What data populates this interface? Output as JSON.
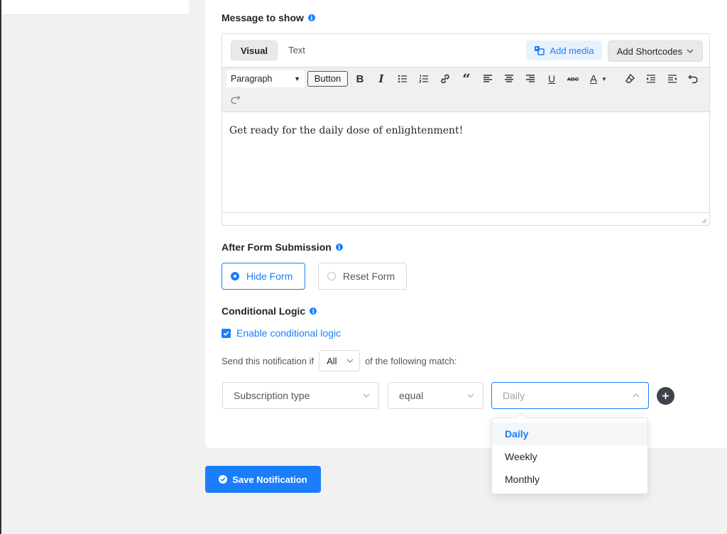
{
  "message_section": {
    "label": "Message to show",
    "tabs": {
      "visual": "Visual",
      "text": "Text"
    },
    "add_media_label": "Add media",
    "add_shortcodes_label": "Add Shortcodes",
    "toolbar": {
      "format_value": "Paragraph",
      "button_label": "Button",
      "icons": [
        "bold-icon",
        "italic-icon",
        "bullet-list-icon",
        "numbered-list-icon",
        "link-icon",
        "blockquote-icon",
        "align-left-icon",
        "align-center-icon",
        "align-right-icon",
        "underline-icon",
        "strikethrough-icon",
        "text-color-icon",
        "clear-formatting-icon",
        "indent-icon",
        "outdent-icon",
        "undo-icon",
        "redo-icon"
      ]
    },
    "body_text": "Get ready for the daily dose of enlightenment!"
  },
  "after_submission": {
    "label": "After Form Submission",
    "options": [
      "Hide Form",
      "Reset Form"
    ],
    "selected": "Hide Form"
  },
  "conditional_logic": {
    "label": "Conditional Logic",
    "enable_label": "Enable conditional logic",
    "enabled": true,
    "send_prefix": "Send this notification if",
    "match_value": "All",
    "send_suffix": "of the following match:",
    "field_value": "Subscription type",
    "operator_value": "equal",
    "value_placeholder": "Daily",
    "dropdown_options": [
      "Daily",
      "Weekly",
      "Monthly"
    ],
    "dropdown_selected": "Daily"
  },
  "save_button_label": "Save Notification",
  "colors": {
    "accent": "#1a7efb",
    "background": "#f1f1f1",
    "card": "#ffffff"
  }
}
